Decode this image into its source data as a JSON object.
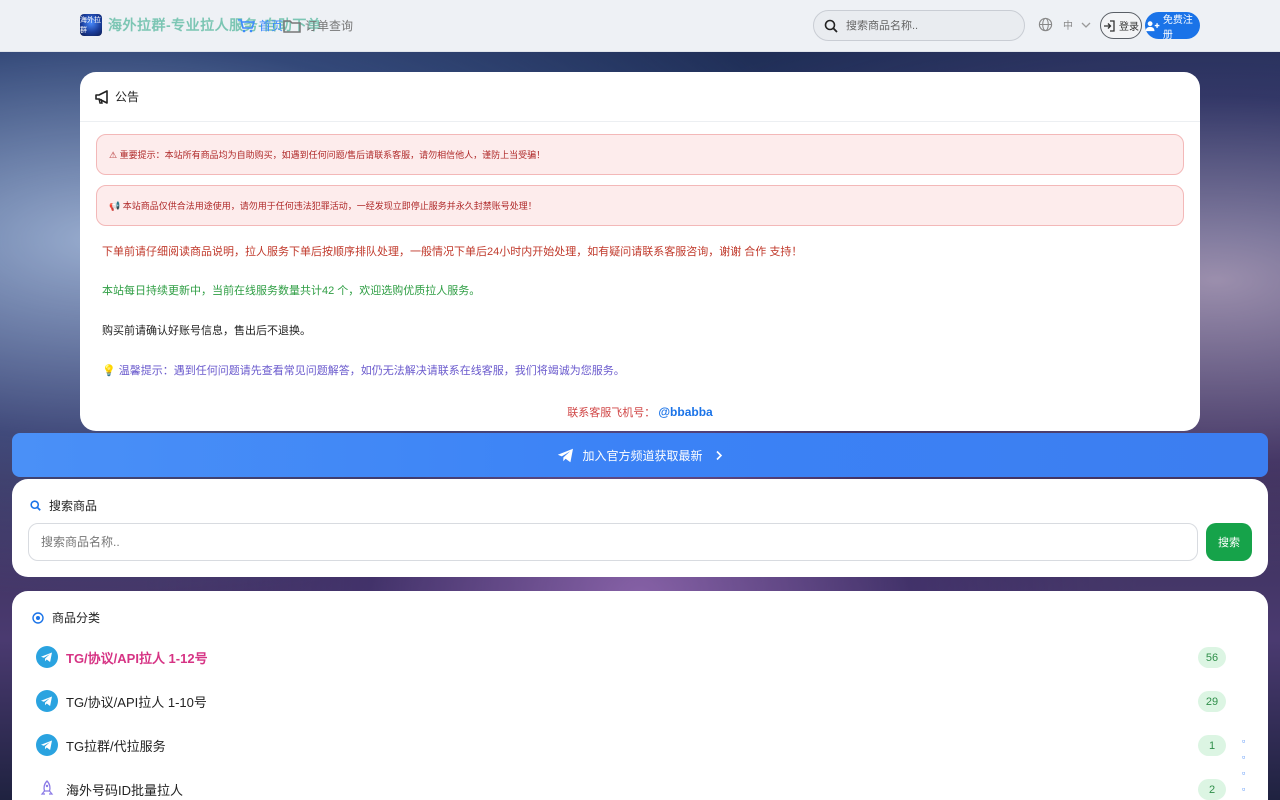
{
  "nav": {
    "brand_logo_text": "海外拉群",
    "brand_name": "海外拉群-专业拉人服务-自助下单",
    "home_label": "首页",
    "orders_label": "订单查询",
    "search_placeholder": "搜索商品名称..",
    "lang_label": "中",
    "login_label": "登录",
    "register_label": "免费注册"
  },
  "notice": {
    "title": "公告",
    "alerts": [
      "⚠ 重要提示：本站所有商品均为自助购买，如遇到任何问题/售后请联系客服，请勿相信他人，谨防上当受骗！",
      "📢 本站商品仅供合法用途使用，请勿用于任何违法犯罪活动，一经发现立即停止服务并永久封禁账号处理！"
    ],
    "line1_text": "下单前请仔细阅读商品说明，拉人服务下单后按顺序排队处理，一般情况下单后24小时内开始处理，如有疑问请联系客服咨询，谢谢 合作 支持！",
    "line2_text": "本站每日持续更新中，当前在线服务数量共计42 个，欢迎选购优质拉人服务。",
    "line3_text": "购买前请确认好账号信息，售出后不退换。",
    "line4_text": "💡 温馨提示：遇到任何问题请先查看常见问题解答，如仍无法解决请联系在线客服，我们将竭诚为您服务。",
    "contact_prefix": "联系客服飞机号：",
    "contact_handle": "@bbabba",
    "highlight_color": "#c0392b"
  },
  "channel_banner": {
    "label": "加入官方频道获取最新"
  },
  "search_card": {
    "title": "搜索商品",
    "placeholder": "搜索商品名称..",
    "button_label": "搜索"
  },
  "categories": {
    "title": "商品分类",
    "items": [
      {
        "name": "TG/协议/API拉人 1-12号",
        "count": "56",
        "hot": true,
        "icon": "telegram-icon"
      },
      {
        "name": "TG/协议/API拉人 1-10号",
        "count": "29",
        "hot": false,
        "icon": "telegram-icon"
      },
      {
        "name": "TG拉群/代拉服务",
        "count": "1",
        "hot": false,
        "icon": "telegram-icon"
      },
      {
        "name": "海外号码ID批量拉人",
        "count": "2",
        "hot": false,
        "icon": "rocket-icon"
      }
    ]
  },
  "colors": {
    "accent": "#1a73e8",
    "brand": "#7cc6b4",
    "success": "#16a34a",
    "danger": "#c0392b",
    "hot": "#d63384"
  }
}
